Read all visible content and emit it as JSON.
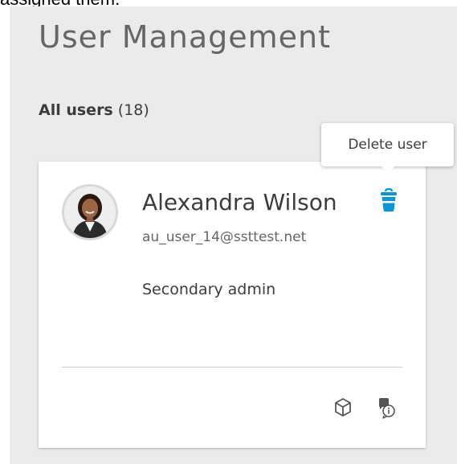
{
  "page": {
    "top_text": "assigned them.",
    "title": "User Management"
  },
  "users_section": {
    "label": "All users",
    "count": "(18)"
  },
  "user_card": {
    "name": "Alexandra Wilson",
    "email": "au_user_14@ssttest.net",
    "role": "Secondary admin",
    "delete_icon": "trash-icon",
    "actions": [
      {
        "icon": "cube-icon"
      },
      {
        "icon": "chat-info-icon"
      }
    ]
  },
  "tooltip": {
    "text": "Delete user"
  },
  "colors": {
    "accent": "#0696d7",
    "panel_bg": "#ebebeb",
    "title_text": "#666666"
  }
}
